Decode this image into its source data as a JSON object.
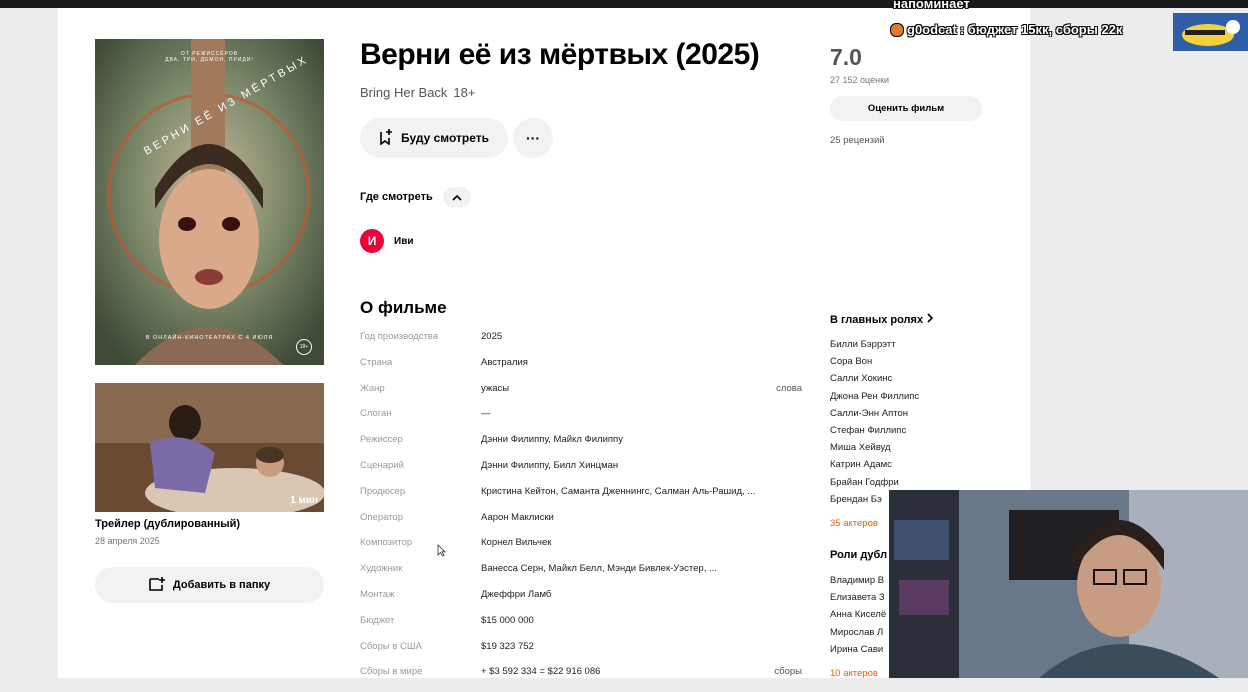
{
  "movie": {
    "title": "Верни её из мёртвых (2025)",
    "original_title": "Bring Her Back",
    "age_rating": "18+",
    "watch_button": "Буду смотреть",
    "more_button": "···",
    "where_to_watch": "Где смотреть",
    "provider": {
      "logo_letter": "И",
      "name": "Иви"
    }
  },
  "poster": {
    "top_text": "ОТ РЕЖИССЁРОВ\nДВА, ТРИ, ДЕМОН, ПРИДИ!",
    "title_text": "ВЕРНИ ЕЁ ИЗ МЁРТВЫХ",
    "bottom_text": "В ОНЛАЙН-КИНОТЕАТРАХ С 4 ИЮЛЯ",
    "age_badge": "18+"
  },
  "trailer": {
    "duration": "1 мин",
    "title": "Трейлер (дублированный)",
    "date": "28 апреля 2025"
  },
  "add_to_folder": "Добавить в папку",
  "about": {
    "heading": "О фильме",
    "facts": [
      {
        "label": "Год производства",
        "value": "2025",
        "extra": ""
      },
      {
        "label": "Страна",
        "value": "Австралия",
        "extra": ""
      },
      {
        "label": "Жанр",
        "value": "ужасы",
        "extra": "слова"
      },
      {
        "label": "Слоган",
        "value": "—",
        "extra": ""
      },
      {
        "label": "Режиссер",
        "value": "Дэнни Филиппу, Майкл Филиппу",
        "extra": ""
      },
      {
        "label": "Сценарий",
        "value": "Дэнни Филиппу, Билл Хинцман",
        "extra": ""
      },
      {
        "label": "Продюсер",
        "value": "Кристина Кейтон, Саманта Дженнингс, Салман Аль-Рашид, ...",
        "extra": ""
      },
      {
        "label": "Оператор",
        "value": "Аарон Маклиски",
        "extra": ""
      },
      {
        "label": "Композитор",
        "value": "Корнел Вильчек",
        "extra": ""
      },
      {
        "label": "Художник",
        "value": "Ванесса Серн, Майкл Белл, Мэнди Бивлек-Уэстер, ...",
        "extra": ""
      },
      {
        "label": "Монтаж",
        "value": "Джеффри Ламб",
        "extra": ""
      },
      {
        "label": "Бюджет",
        "value": "$15 000 000",
        "extra": ""
      },
      {
        "label": "Сборы в США",
        "value": "$19 323 752",
        "extra": ""
      },
      {
        "label": "Сборы в мире",
        "value": "+ $3 592 334 = $22 916 086",
        "extra": "сборы"
      }
    ]
  },
  "rating": {
    "value": "7.0",
    "votes": "27 152 оценки",
    "rate_button": "Оценить фильм",
    "reviews": "25 рецензий"
  },
  "cast": {
    "heading": "В главных ролях",
    "actors": [
      "Билли Бэррэтт",
      "Сора Вон",
      "Салли Хокинс",
      "Джона Рен Филлипс",
      "Салли-Энн Аптон",
      "Стефан Филлипс",
      "Миша Хейвуд",
      "Катрин Адамс",
      "Брайан Годфри",
      "Брендан Бэ"
    ],
    "more": "35 актеров"
  },
  "dubbing": {
    "heading": "Роли дубл",
    "actors": [
      "Владимир В",
      "Елизавета З",
      "Анна Киселё",
      "Мирослав Л",
      "Ирина Сави"
    ],
    "more": "10 актеров"
  },
  "stream_overlay": {
    "prev_line": "напоминает",
    "user": "g0odcat",
    "message": ": бюджет 15кк, сборы 22к"
  },
  "colors": {
    "accent": "#f05a00",
    "ivi": "#ea003d",
    "button_bg": "#f2f2f2"
  }
}
